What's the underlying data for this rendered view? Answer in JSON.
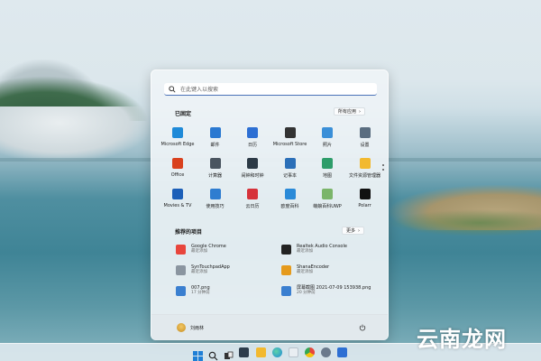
{
  "search": {
    "placeholder": "在此键入以搜索"
  },
  "pinned": {
    "title": "已固定",
    "all_apps_label": "所有应用",
    "apps": [
      {
        "label": "Microsoft Edge",
        "icon": "edge-icon",
        "color": "#1f8ad8"
      },
      {
        "label": "邮件",
        "icon": "mail-icon",
        "color": "#2b79d1"
      },
      {
        "label": "日历",
        "icon": "calendar-icon",
        "color": "#2d6fd3"
      },
      {
        "label": "Microsoft Store",
        "icon": "store-icon",
        "color": "#333333"
      },
      {
        "label": "照片",
        "icon": "photos-icon",
        "color": "#3a8fd8"
      },
      {
        "label": "设置",
        "icon": "settings-icon",
        "color": "#5a6d80"
      },
      {
        "label": "Office",
        "icon": "office-icon",
        "color": "#d9411e"
      },
      {
        "label": "计算器",
        "icon": "calculator-icon",
        "color": "#4a5560"
      },
      {
        "label": "闹钟和时钟",
        "icon": "clock-icon",
        "color": "#2c3a46"
      },
      {
        "label": "记事本",
        "icon": "notepad-icon",
        "color": "#2b6fb8"
      },
      {
        "label": "地图",
        "icon": "maps-icon",
        "color": "#2e9d6a"
      },
      {
        "label": "文件资源管理器",
        "icon": "folder-icon",
        "color": "#f2b92f"
      },
      {
        "label": "Movies & TV",
        "icon": "movies-icon",
        "color": "#1c5fb8"
      },
      {
        "label": "使用技巧",
        "icon": "tips-icon",
        "color": "#2f7dd0"
      },
      {
        "label": "云日历",
        "icon": "cloud-calendar-icon",
        "color": "#d6323a"
      },
      {
        "label": "欧度百科",
        "icon": "encyclopedia-icon",
        "color": "#2a8ad8"
      },
      {
        "label": "萌娘百科UWP",
        "icon": "moegirl-icon",
        "color": "#7bb56a"
      },
      {
        "label": "Polarr",
        "icon": "polarr-icon",
        "color": "#111111"
      }
    ]
  },
  "recommended": {
    "title": "推荐的项目",
    "more_label": "更多",
    "items": [
      {
        "title": "Google Chrome",
        "subtitle": "最近添加",
        "icon": "chrome-icon",
        "color": "#e8453c"
      },
      {
        "title": "Realtek Audio Console",
        "subtitle": "最近添加",
        "icon": "realtek-icon",
        "color": "#222222"
      },
      {
        "title": "SynTouchpadApp",
        "subtitle": "最近添加",
        "icon": "touchpad-icon",
        "color": "#8a95a0"
      },
      {
        "title": "ShanaEncoder",
        "subtitle": "最近添加",
        "icon": "shana-icon",
        "color": "#e59a1c"
      },
      {
        "title": "007.png",
        "subtitle": "17 分钟前",
        "icon": "image-file-icon",
        "color": "#3a7fd0"
      },
      {
        "title": "屏幕截图 2021-07-09 153938.png",
        "subtitle": "20 分钟前",
        "icon": "image-file-icon",
        "color": "#3a7fd0"
      }
    ]
  },
  "user": {
    "name": "刘雨林"
  },
  "watermark": "云南龙网"
}
